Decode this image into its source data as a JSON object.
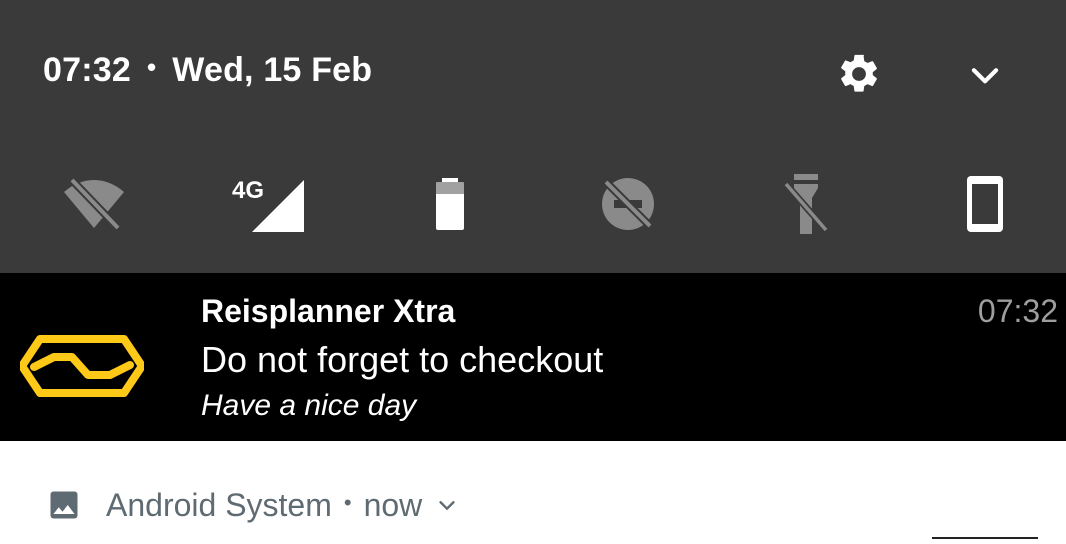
{
  "status_header": {
    "time": "07:32",
    "separator": "•",
    "date": "Wed, 15 Feb"
  },
  "quick_settings": [
    {
      "name": "wifi-off-icon",
      "label_overlay": ""
    },
    {
      "name": "cellular-4g-icon",
      "label_overlay": "4G"
    },
    {
      "name": "battery-icon",
      "label_overlay": ""
    },
    {
      "name": "do-not-disturb-off-icon",
      "label_overlay": ""
    },
    {
      "name": "flashlight-off-icon",
      "label_overlay": ""
    },
    {
      "name": "auto-rotate-portrait-icon",
      "label_overlay": ""
    }
  ],
  "notification": {
    "app_title": "Reisplanner Xtra",
    "text": "Do not forget to checkout",
    "subtext": "Have a nice day",
    "time": "07:32",
    "accent": "#ffc917"
  },
  "system_notification": {
    "app_name": "Android System",
    "separator": "•",
    "when": "now"
  },
  "colors": {
    "shade_bg": "#3a3a3a",
    "notification_bg": "#000000",
    "icon_muted": "#8a8a8a",
    "system_text": "#5f6b73"
  }
}
